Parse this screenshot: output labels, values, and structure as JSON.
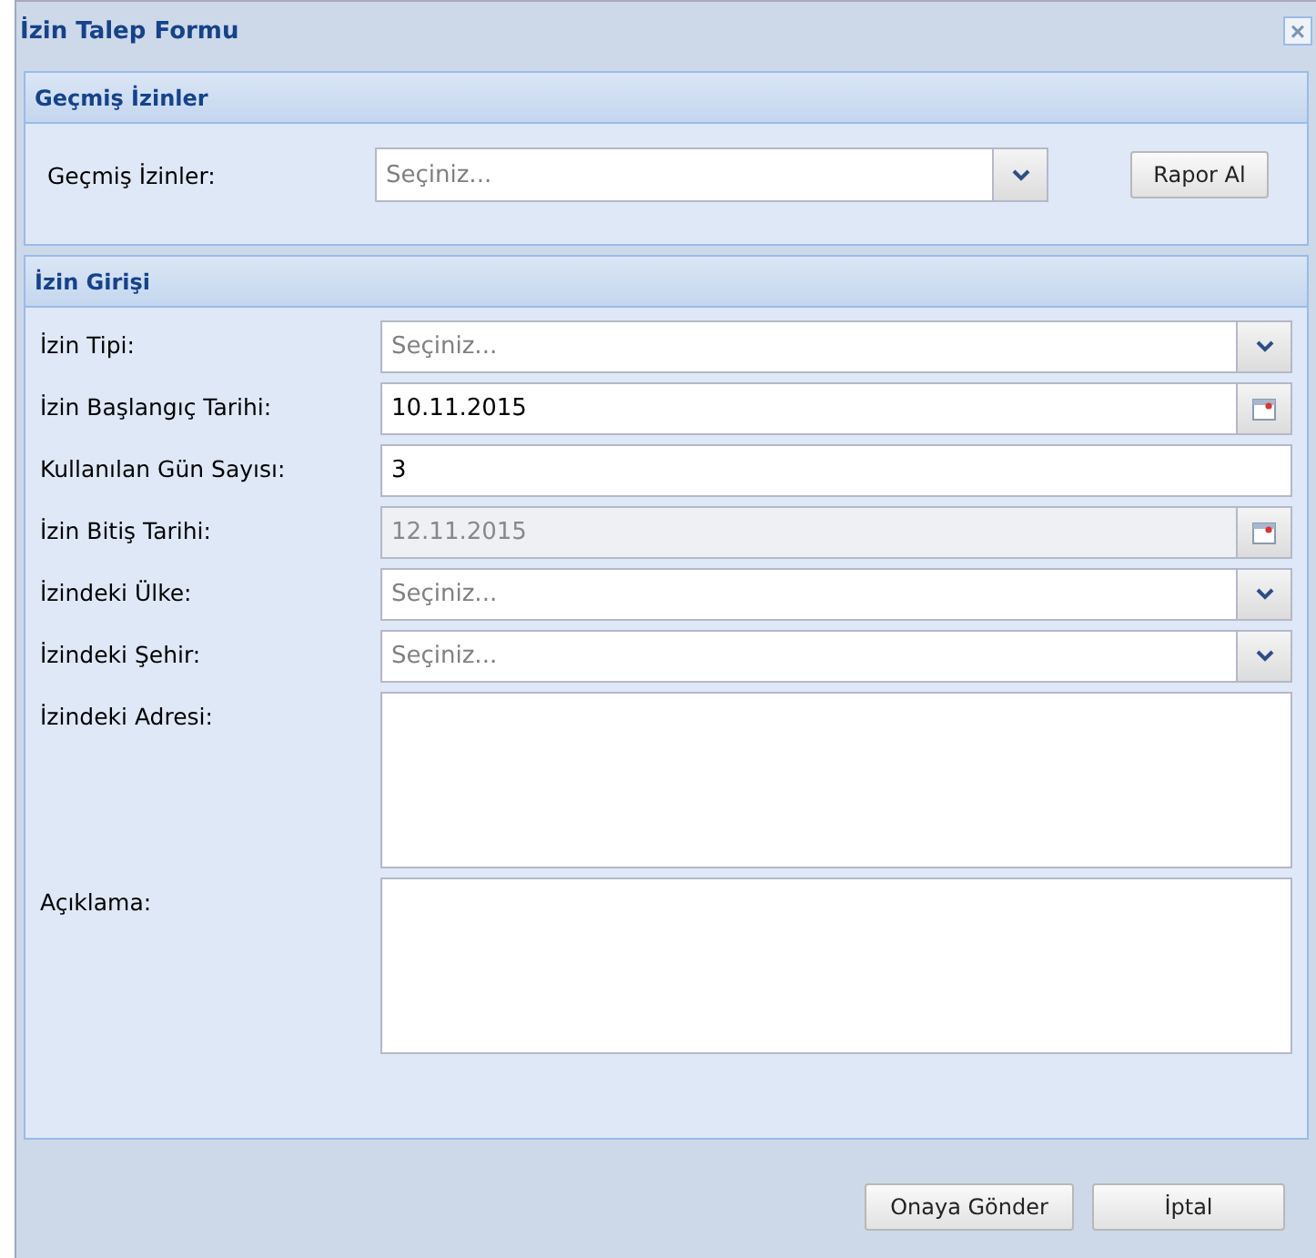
{
  "window": {
    "title": "İzin Talep Formu",
    "close": "×"
  },
  "past_section": {
    "title": "Geçmiş İzinler",
    "label": "Geçmiş İzinler:",
    "placeholder": "Seçiniz...",
    "button": "Rapor Al"
  },
  "entry_section": {
    "title": "İzin Girişi",
    "fields": [
      {
        "label": "İzin Tipi:",
        "kind": "combo",
        "placeholder": "Seçiniz..."
      },
      {
        "label": "İzin Başlangıç Tarihi:",
        "kind": "date",
        "value": "10.11.2015",
        "disabled": false
      },
      {
        "label": "Kullanılan Gün Sayısı:",
        "kind": "text",
        "value": "3",
        "disabled": false
      },
      {
        "label": "İzin Bitiş Tarihi:",
        "kind": "date",
        "value": "12.11.2015",
        "disabled": true
      },
      {
        "label": "İzindeki Ülke:",
        "kind": "combo",
        "placeholder": "Seçiniz..."
      },
      {
        "label": "İzindeki Şehir:",
        "kind": "combo",
        "placeholder": "Seçiniz..."
      },
      {
        "label": "İzindeki Adresi:",
        "kind": "textarea"
      },
      {
        "label": "Açıklama:",
        "kind": "textarea"
      }
    ]
  },
  "buttons": [
    "Onaya Gönder",
    "İptal"
  ]
}
